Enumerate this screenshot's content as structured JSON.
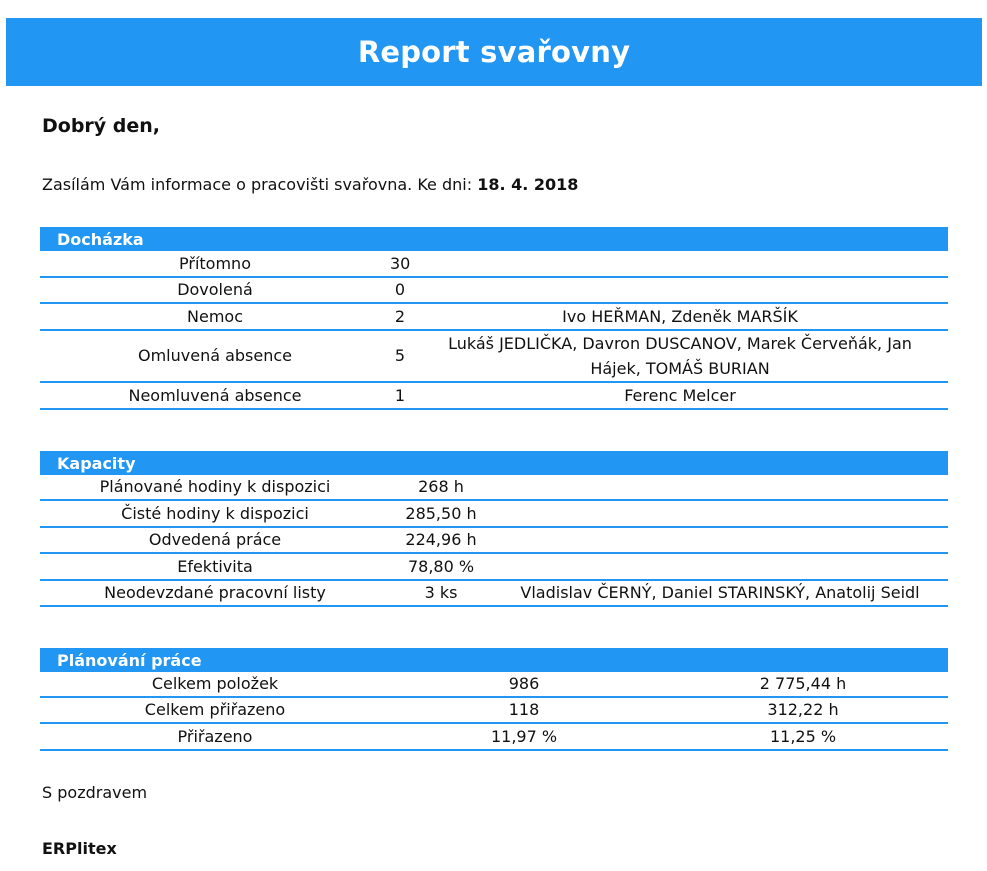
{
  "header": {
    "title": "Report svařovny"
  },
  "greeting": "Dobrý den,",
  "intro": {
    "text": "Zasílám Vám informace o pracovišti svařovna. Ke dni: ",
    "date": "18. 4. 2018"
  },
  "attendance": {
    "title": "Docházka",
    "rows": [
      {
        "label": "Přítomno",
        "value": "30",
        "names": ""
      },
      {
        "label": "Dovolená",
        "value": "0",
        "names": ""
      },
      {
        "label": "Nemoc",
        "value": "2",
        "names": "Ivo HEŘMAN, Zdeněk MARŠÍK"
      },
      {
        "label": "Omluvená absence",
        "value": "5",
        "names": "Lukáš JEDLIČKA, Davron DUSCANOV, Marek Červeňák, Jan Hájek, TOMÁŠ BURIAN"
      },
      {
        "label": "Neomluvená absence",
        "value": "1",
        "names": "Ferenc Melcer"
      }
    ]
  },
  "capacity": {
    "title": "Kapacity",
    "rows": [
      {
        "label": "Plánované hodiny k dispozici",
        "value": "268 h",
        "names": ""
      },
      {
        "label": "Čisté hodiny k dispozici",
        "value": "285,50 h",
        "names": ""
      },
      {
        "label": "Odvedená práce",
        "value": "224,96 h",
        "names": ""
      },
      {
        "label": "Efektivita",
        "value": "78,80 %",
        "names": ""
      },
      {
        "label": "Neodevzdané pracovní listy",
        "value": "3 ks",
        "names": "Vladislav ČERNÝ, Daniel STARINSKÝ, Anatolij Seidl"
      }
    ]
  },
  "planning": {
    "title": "Plánování práce",
    "rows": [
      {
        "label": "Celkem položek",
        "count": "986",
        "hours": "2 775,44 h"
      },
      {
        "label": "Celkem přiřazeno",
        "count": "118",
        "hours": "312,22 h"
      },
      {
        "label": "Přiřazeno",
        "count": "11,97 %",
        "hours": "11,25 %"
      }
    ]
  },
  "closing": "S pozdravem",
  "signature": "ERPlitex",
  "colors": {
    "accent": "#2196f3",
    "text": "#111111",
    "background": "#ffffff"
  }
}
